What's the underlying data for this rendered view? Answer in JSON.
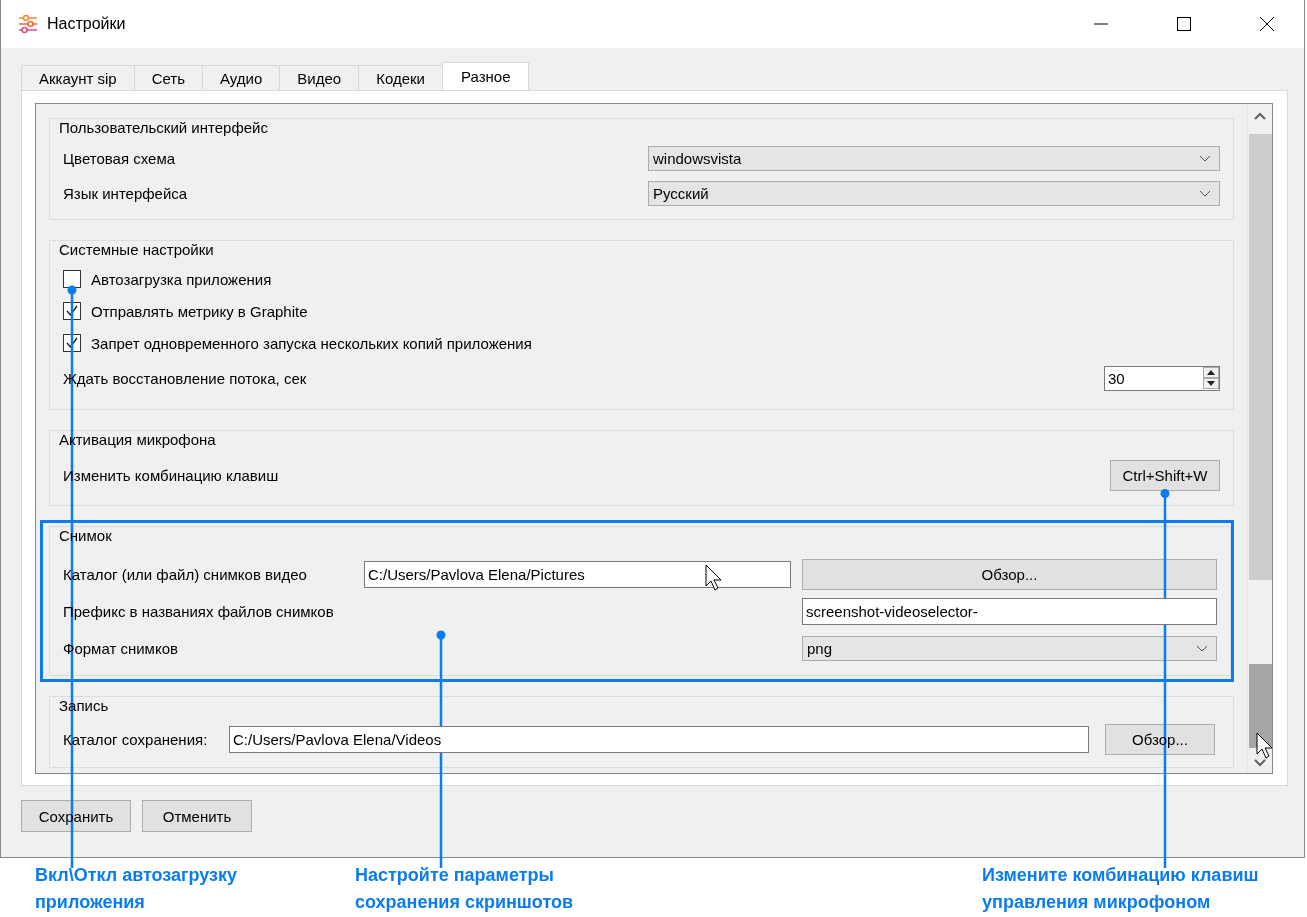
{
  "window": {
    "title": "Настройки"
  },
  "tabs": [
    {
      "label": "Аккаунт sip",
      "selected": false
    },
    {
      "label": "Сеть",
      "selected": false
    },
    {
      "label": "Аудио",
      "selected": false
    },
    {
      "label": "Видео",
      "selected": false
    },
    {
      "label": "Кодеки",
      "selected": false
    },
    {
      "label": "Разное",
      "selected": true
    }
  ],
  "groups": [
    {
      "title": "Пользовательский интерфейс",
      "kind": "list",
      "highlighted": false,
      "rows": [
        {
          "kind": "combo",
          "label": "Цветовая схема",
          "value": "windowsvista"
        },
        {
          "kind": "combo",
          "label": "Язык интерфейса",
          "value": "Русский"
        }
      ]
    },
    {
      "title": "Системные настройки",
      "kind": "list",
      "highlighted": false,
      "rows": [
        {
          "kind": "checkbox",
          "label": "Автозагрузка приложения",
          "checked": false
        },
        {
          "kind": "checkbox",
          "label": "Отправлять метрику в Graphite",
          "checked": true
        },
        {
          "kind": "checkbox",
          "label": "Запрет одновременного запуска нескольких копий приложения",
          "checked": true
        },
        {
          "kind": "spin",
          "label": "Ждать восстановление потока, сек",
          "value": "30"
        }
      ]
    },
    {
      "title": "Активация микрофона",
      "kind": "list",
      "highlighted": false,
      "rows": [
        {
          "kind": "keybutton",
          "label": "Изменить комбинацию клавиш",
          "value": "Ctrl+Shift+W"
        }
      ]
    },
    {
      "title": "Снимок",
      "kind": "grid",
      "highlighted": true,
      "rows": [
        {
          "kind": "path",
          "label": "Каталог (или файл) снимков видео",
          "value": "C:/Users/Pavlova Elena/Pictures",
          "button": "Обзор..."
        },
        {
          "kind": "text",
          "label": "Префикс в названиях файлов снимков",
          "value": "screenshot-videoselector-"
        },
        {
          "kind": "combo",
          "label": "Формат снимков",
          "value": "png"
        }
      ]
    },
    {
      "title": "Запись",
      "kind": "list",
      "highlighted": false,
      "rows": [
        {
          "kind": "path",
          "label": "Каталог сохранения:",
          "value": "C:/Users/Pavlova Elena/Videos",
          "button": "Обзор..."
        }
      ]
    }
  ],
  "buttons": [
    "Сохранить",
    "Отменить"
  ],
  "callouts": [
    "Вкл\\Откл автозагрузку приложения",
    "Настройте параметры сохранения скриншотов",
    "Измените комбинацию клавиш управления микрофоном"
  ]
}
